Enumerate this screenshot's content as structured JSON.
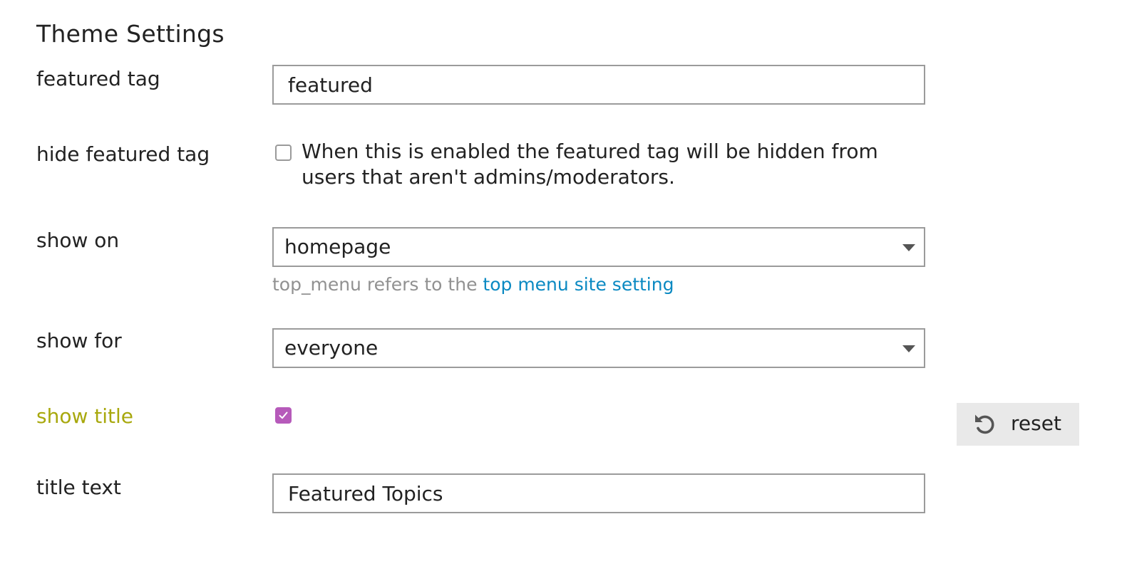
{
  "page": {
    "title": "Theme Settings"
  },
  "settings": {
    "featured_tag": {
      "label": "featured tag",
      "value": "featured"
    },
    "hide_featured_tag": {
      "label": "hide featured tag",
      "checked": false,
      "description": "When this is enabled the featured tag will be hidden from users that aren't admins/moderators."
    },
    "show_on": {
      "label": "show on",
      "selected": "homepage",
      "help_prefix": "top_menu refers to the ",
      "help_link": "top menu site setting"
    },
    "show_for": {
      "label": "show for",
      "selected": "everyone"
    },
    "show_title": {
      "label": "show title",
      "checked": true,
      "reset_label": "reset"
    },
    "title_text": {
      "label": "title text",
      "value": "Featured Topics"
    }
  },
  "colors": {
    "changed_label": "#a8a80d",
    "checkbox_checked": "#b65aba",
    "link": "#0a89c2",
    "help_text": "#919191",
    "reset_button_bg": "#e9e9e9"
  },
  "icons": {
    "dropdown": "caret-down-icon",
    "checkmark": "check-icon",
    "reset": "undo-icon"
  }
}
